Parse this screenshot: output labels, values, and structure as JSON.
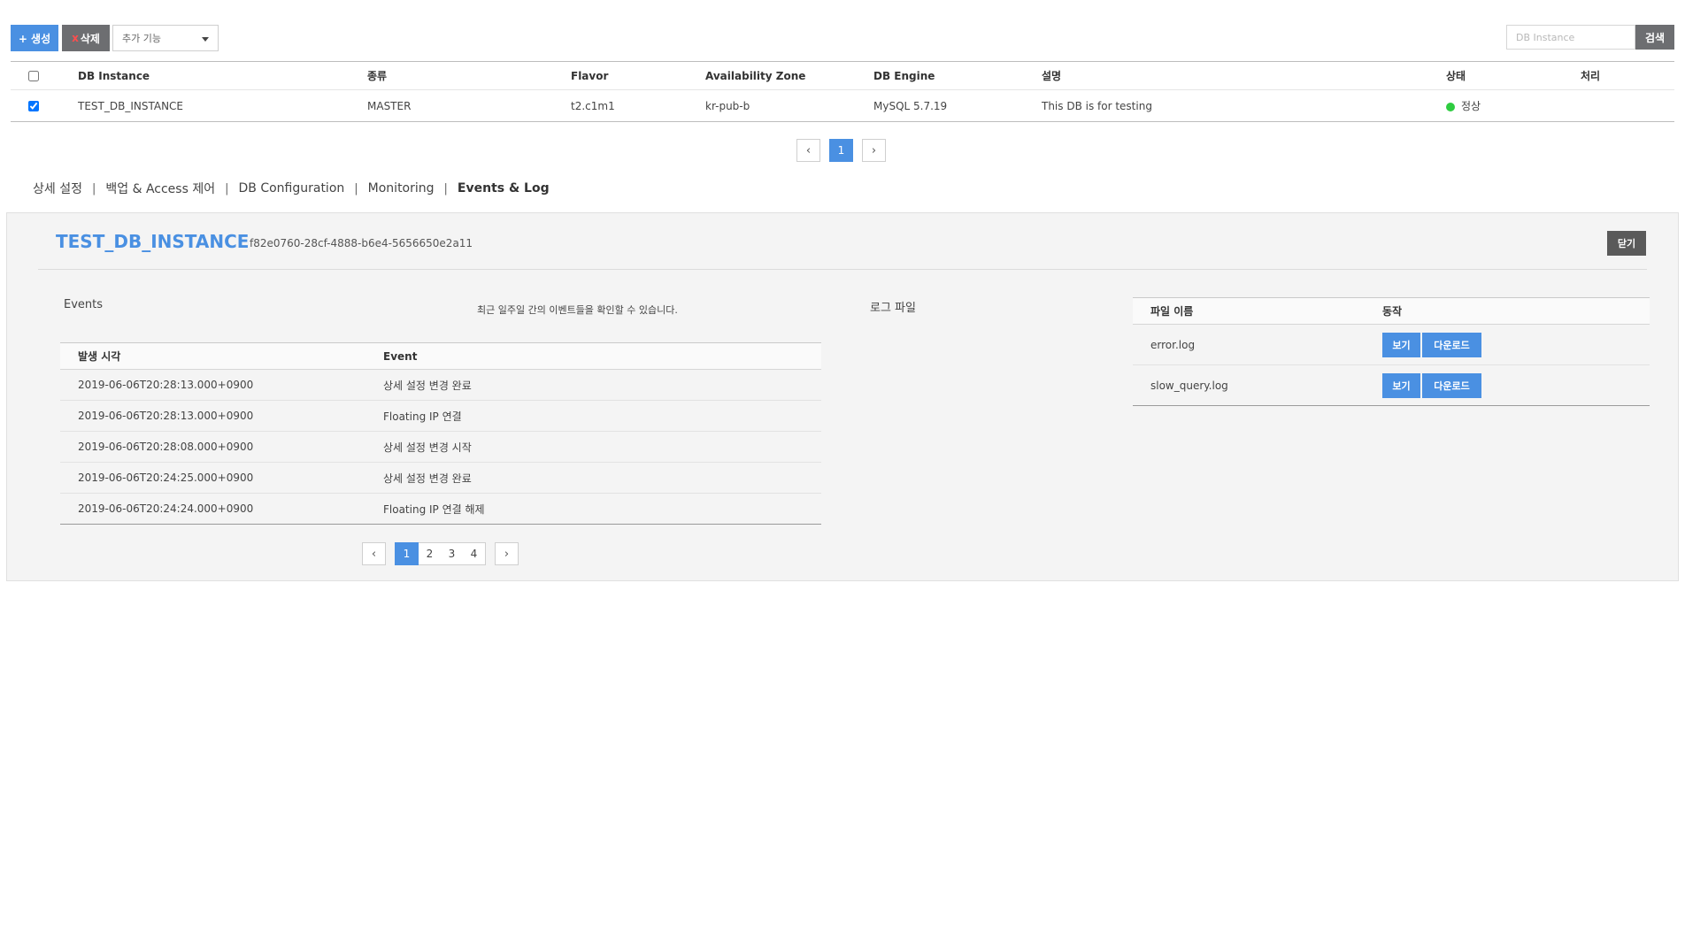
{
  "toolbar": {
    "create_label": "+ 생성",
    "delete_x": "x",
    "delete_label": "삭제",
    "extra_select": "추가 기능",
    "search_placeholder": "DB Instance",
    "search_label": "검색"
  },
  "instances": {
    "headers": [
      "DB Instance",
      "종류",
      "Flavor",
      "Availability Zone",
      "DB Engine",
      "설명",
      "상태",
      "처리"
    ],
    "rows": [
      {
        "checked": true,
        "name": "TEST_DB_INSTANCE",
        "type": "MASTER",
        "flavor": "t2.c1m1",
        "az": "kr-pub-b",
        "engine": "MySQL 5.7.19",
        "desc": "This DB is for testing",
        "status": "정상",
        "status_color": "#2ecc40",
        "action": ""
      }
    ]
  },
  "main_pager": {
    "pages": [
      "1"
    ],
    "active": "1"
  },
  "tabs": [
    "상세 설정",
    "백업 & Access 제어",
    "DB Configuration",
    "Monitoring",
    "Events & Log"
  ],
  "tab_separator": "|",
  "active_tab": "Events & Log",
  "detail": {
    "title": "TEST_DB_INSTANCE",
    "instance_id": "f82e0760-28cf-4888-b6e4-5656650e2a11",
    "close_label": "닫기",
    "events_label": "Events",
    "events_note": "최근 일주일 간의 이벤트들을 확인할 수 있습니다.",
    "events_headers": [
      "발생 시각",
      "Event"
    ],
    "events": [
      {
        "time": "2019-06-06T20:28:13.000+0900",
        "event": "상세 설정 변경 완료"
      },
      {
        "time": "2019-06-06T20:28:13.000+0900",
        "event": "Floating IP 연결"
      },
      {
        "time": "2019-06-06T20:28:08.000+0900",
        "event": "상세 설정 변경 시작"
      },
      {
        "time": "2019-06-06T20:24:25.000+0900",
        "event": "상세 설정 변경 완료"
      },
      {
        "time": "2019-06-06T20:24:24.000+0900",
        "event": "Floating IP 연결 해제"
      }
    ],
    "events_pager": {
      "pages": [
        "1",
        "2",
        "3",
        "4"
      ],
      "active": "1"
    },
    "logs_label": "로그 파일",
    "logs_headers": [
      "파일 이름",
      "동작"
    ],
    "logs": [
      {
        "file": "error.log",
        "view": "보기",
        "download": "다운로드"
      },
      {
        "file": "slow_query.log",
        "view": "보기",
        "download": "다운로드"
      }
    ]
  },
  "colors": {
    "accent": "#4a90e2",
    "dark_button": "#6d6e71",
    "status_ok": "#2ecc40"
  }
}
